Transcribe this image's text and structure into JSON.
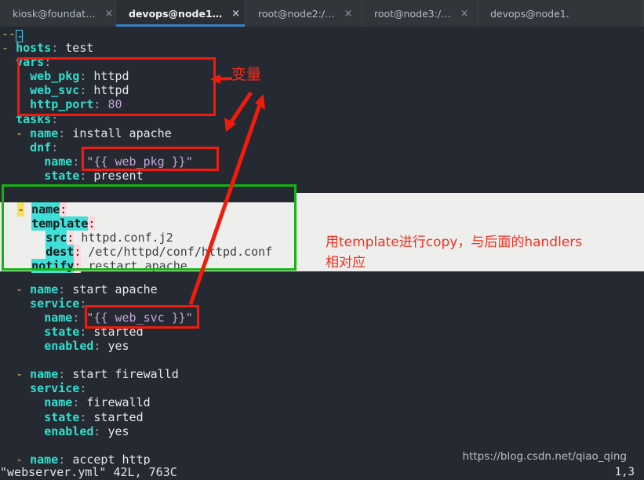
{
  "window": {
    "tabs": [
      {
        "label": "kiosk@foundat…",
        "close": "×",
        "active": false
      },
      {
        "label": "devops@node1…",
        "close": "×",
        "active": true
      },
      {
        "label": "root@node2:/…",
        "close": "×",
        "active": false
      },
      {
        "label": "root@node3:/…",
        "close": "×",
        "active": false
      },
      {
        "label": "devops@node1.",
        "close": "",
        "active": false
      }
    ]
  },
  "editor": {
    "file_type": "yaml",
    "lines": [
      {
        "id": "l1",
        "indent": 0,
        "dash": "",
        "key": "",
        "colon": "",
        "value": "",
        "prefix": "--",
        "cursor": "-"
      },
      {
        "id": "l2",
        "indent": 0,
        "dash": "-",
        "key": "hosts",
        "colon": ":",
        "value": "test",
        "vclass": "v"
      },
      {
        "id": "l3",
        "indent": 1,
        "dash": "",
        "key": "vars",
        "colon": ":",
        "value": "",
        "vclass": "v"
      },
      {
        "id": "l4",
        "indent": 2,
        "dash": "",
        "key": "web_pkg",
        "colon": ":",
        "value": "httpd",
        "vclass": "v"
      },
      {
        "id": "l5",
        "indent": 2,
        "dash": "",
        "key": "web_svc",
        "colon": ":",
        "value": "httpd",
        "vclass": "v"
      },
      {
        "id": "l6",
        "indent": 2,
        "dash": "",
        "key": "http_port",
        "colon": ":",
        "value": "80",
        "vclass": "num"
      },
      {
        "id": "l7",
        "indent": 1,
        "dash": "",
        "key": "tasks",
        "colon": ":",
        "value": "",
        "vclass": "v"
      },
      {
        "id": "l8",
        "indent": 1,
        "dash": "-",
        "key": "name",
        "colon": ":",
        "value": "install apache",
        "vclass": "v"
      },
      {
        "id": "l9",
        "indent": 2,
        "dash": "",
        "key": "dnf",
        "colon": ":",
        "value": "",
        "vclass": "v"
      },
      {
        "id": "l10",
        "indent": 3,
        "dash": "",
        "key": "name",
        "colon": ":",
        "value": "\"{{ web_pkg }}\"",
        "vclass": "str"
      },
      {
        "id": "l11",
        "indent": 3,
        "dash": "",
        "key": "state",
        "colon": ":",
        "value": "present",
        "vclass": "v"
      },
      {
        "id": "l12",
        "indent": 0,
        "dash": "",
        "key": "",
        "colon": "",
        "value": "",
        "vclass": "v"
      },
      {
        "id": "l13",
        "indent": 0,
        "dash": "",
        "key": "",
        "colon": "",
        "value": "",
        "vclass": "v"
      },
      {
        "id": "l14",
        "indent": 0,
        "dash": "",
        "key": "",
        "colon": "",
        "value": "",
        "vclass": "v"
      },
      {
        "id": "l15",
        "indent": 0,
        "dash": "",
        "key": "",
        "colon": "",
        "value": "",
        "vclass": "v"
      },
      {
        "id": "l16",
        "indent": 0,
        "dash": "",
        "key": "",
        "colon": "",
        "value": "",
        "vclass": "v"
      },
      {
        "id": "l17",
        "indent": 0,
        "dash": "",
        "key": "",
        "colon": "",
        "value": "",
        "vclass": "v"
      },
      {
        "id": "l18",
        "indent": 0,
        "dash": "",
        "key": "",
        "colon": "",
        "value": "",
        "vclass": "v"
      },
      {
        "id": "l19",
        "indent": 1,
        "dash": "-",
        "key": "name",
        "colon": ":",
        "value": "start apache",
        "vclass": "v"
      },
      {
        "id": "l20",
        "indent": 2,
        "dash": "",
        "key": "service",
        "colon": ":",
        "value": "",
        "vclass": "v"
      },
      {
        "id": "l21",
        "indent": 3,
        "dash": "",
        "key": "name",
        "colon": ":",
        "value": "\"{{ web_svc }}\"",
        "vclass": "str"
      },
      {
        "id": "l22",
        "indent": 3,
        "dash": "",
        "key": "state",
        "colon": ":",
        "value": "started",
        "vclass": "v"
      },
      {
        "id": "l23",
        "indent": 3,
        "dash": "",
        "key": "enabled",
        "colon": ":",
        "value": "yes",
        "vclass": "v"
      },
      {
        "id": "l24",
        "indent": 0,
        "dash": "",
        "key": "",
        "colon": "",
        "value": "",
        "vclass": "v"
      },
      {
        "id": "l25",
        "indent": 1,
        "dash": "-",
        "key": "name",
        "colon": ":",
        "value": "start firewalld",
        "vclass": "v"
      },
      {
        "id": "l26",
        "indent": 2,
        "dash": "",
        "key": "service",
        "colon": ":",
        "value": "",
        "vclass": "v"
      },
      {
        "id": "l27",
        "indent": 3,
        "dash": "",
        "key": "name",
        "colon": ":",
        "value": "firewalld",
        "vclass": "v"
      },
      {
        "id": "l28",
        "indent": 3,
        "dash": "",
        "key": "state",
        "colon": ":",
        "value": "started",
        "vclass": "v"
      },
      {
        "id": "l29",
        "indent": 3,
        "dash": "",
        "key": "enabled",
        "colon": ":",
        "value": "yes",
        "vclass": "v"
      },
      {
        "id": "l30",
        "indent": 0,
        "dash": "",
        "key": "",
        "colon": "",
        "value": "",
        "vclass": "v"
      },
      {
        "id": "l31",
        "indent": 1,
        "dash": "-",
        "key": "name",
        "colon": ":",
        "value": "accept http",
        "vclass": "v"
      }
    ],
    "selected_block": [
      {
        "id": "s1",
        "indent": 1,
        "dash": "-",
        "key": "name",
        "colon": ":",
        "value": ""
      },
      {
        "id": "s2",
        "indent": 2,
        "dash": "",
        "key": "template",
        "colon": ":",
        "value": ""
      },
      {
        "id": "s3",
        "indent": 3,
        "dash": "",
        "key": "src",
        "colon": ":",
        "value": "httpd.conf.j2"
      },
      {
        "id": "s4",
        "indent": 3,
        "dash": "",
        "key": "dest",
        "colon": ":",
        "value": "/etc/httpd/conf/httpd.conf"
      },
      {
        "id": "s5",
        "indent": 2,
        "dash": "",
        "key": "notify",
        "colon": ":",
        "value": "restart apache"
      }
    ]
  },
  "annotations": {
    "vars_label": "变量",
    "template_note_line1": "用template进行copy，与后面的handlers",
    "template_note_line2": "相对应"
  },
  "status": {
    "file_info": "\"webserver.yml\" 42L, 763C",
    "cursor_position": "1,3"
  },
  "watermark": {
    "text": "https://blog.csdn.net/qiao_qing"
  },
  "colors": {
    "tabbar_bg": "#31363b",
    "active_tab_bg": "#2b2f34",
    "active_tab_underline": "#3a7fc1",
    "terminal_bg": "#252931",
    "yaml_key": "#2fe0d0",
    "yaml_dash": "#d8c157",
    "yaml_value": "#e6e9ed",
    "yaml_number": "#c3a6d8",
    "selection_bg": "#eeeeec",
    "selection_key_bg": "#3fe0d8",
    "selection_colon_bg": "#ffd8dd",
    "selection_dash_bg": "#f5e05a",
    "annotation_red": "#f22f1f",
    "box_red": "#f21b0c",
    "box_green": "#12b512"
  }
}
